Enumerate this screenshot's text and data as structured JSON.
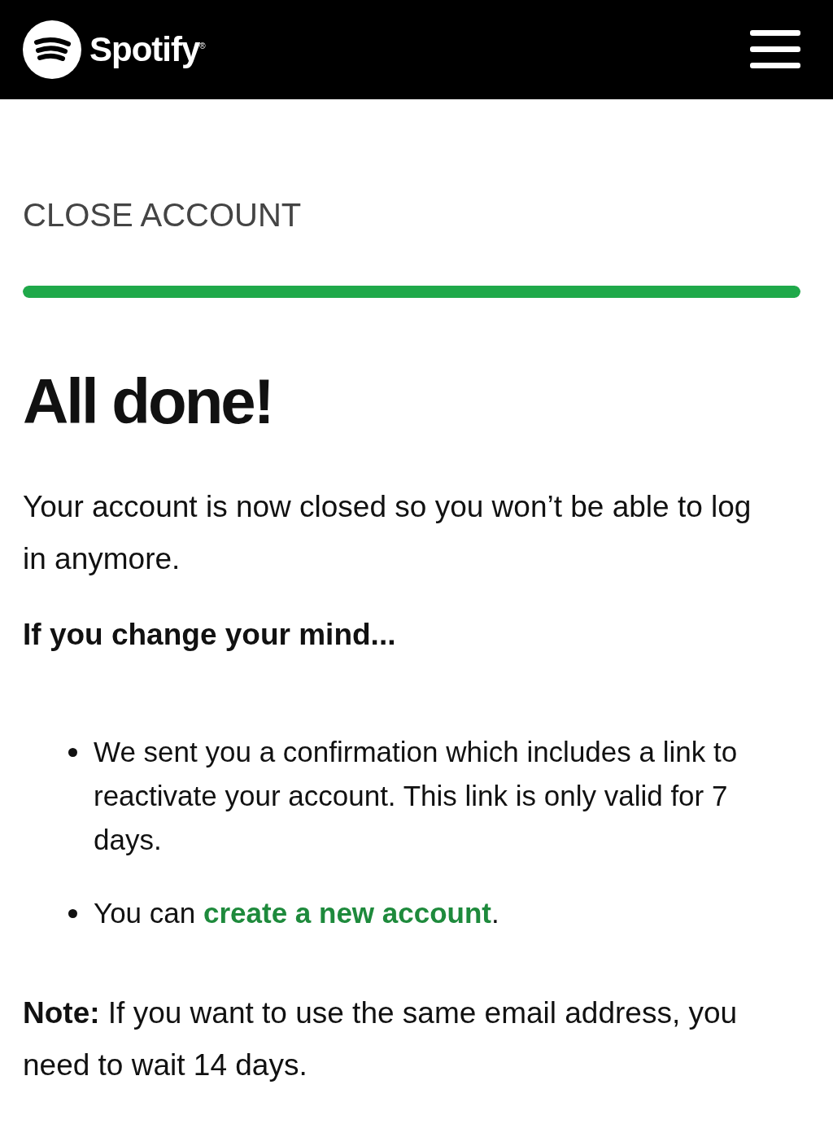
{
  "header": {
    "logo": "Spotify",
    "trademark": "®"
  },
  "section_title": "CLOSE ACCOUNT",
  "progress": {
    "level": 1
  },
  "heading": "All done!",
  "message": "Your account is now closed so you won’t be able to log in anymore.",
  "subheading": "If you change your mind...",
  "bullets": [
    {
      "kind": "text",
      "text": "We sent you a confirmation which includes a link to reactivate your account. This link is only valid for 7 days."
    },
    {
      "kind": "link",
      "before": "You can ",
      "link": "create a new account",
      "after": "."
    }
  ],
  "note": "**Note:** If you want to use the same email address, you need to wait 14 days."
}
